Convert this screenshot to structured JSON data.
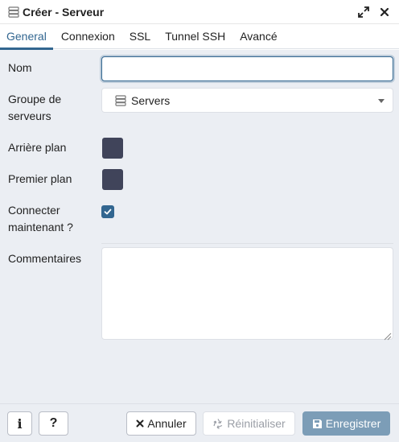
{
  "window": {
    "title": "Créer - Serveur",
    "server_icon": "server-icon",
    "expand_icon": "expand-icon",
    "close_icon": "close-icon"
  },
  "tabs": [
    {
      "label": "General",
      "active": true
    },
    {
      "label": "Connexion",
      "active": false
    },
    {
      "label": "SSL",
      "active": false
    },
    {
      "label": "Tunnel SSH",
      "active": false
    },
    {
      "label": "Avancé",
      "active": false
    }
  ],
  "form": {
    "name": {
      "label": "Nom",
      "value": ""
    },
    "group": {
      "label_line1": "Groupe de",
      "label_line2": "serveurs",
      "value": "Servers",
      "icon": "server-group-icon"
    },
    "background": {
      "label": "Arrière plan",
      "color": "#40445a"
    },
    "foreground": {
      "label": "Premier plan",
      "color": "#40445a"
    },
    "connect_now": {
      "label_line1": "Connecter",
      "label_line2": "maintenant ?",
      "checked": true
    },
    "comments": {
      "label": "Commentaires",
      "value": ""
    }
  },
  "footer": {
    "info_label": "i",
    "help_label": "?",
    "cancel_label": "Annuler",
    "reset_label": "Réinitialiser",
    "save_label": "Enregistrer"
  },
  "colors": {
    "accent": "#326690",
    "panel_bg": "#ebeef3",
    "primary_button": "#7c9db7"
  }
}
